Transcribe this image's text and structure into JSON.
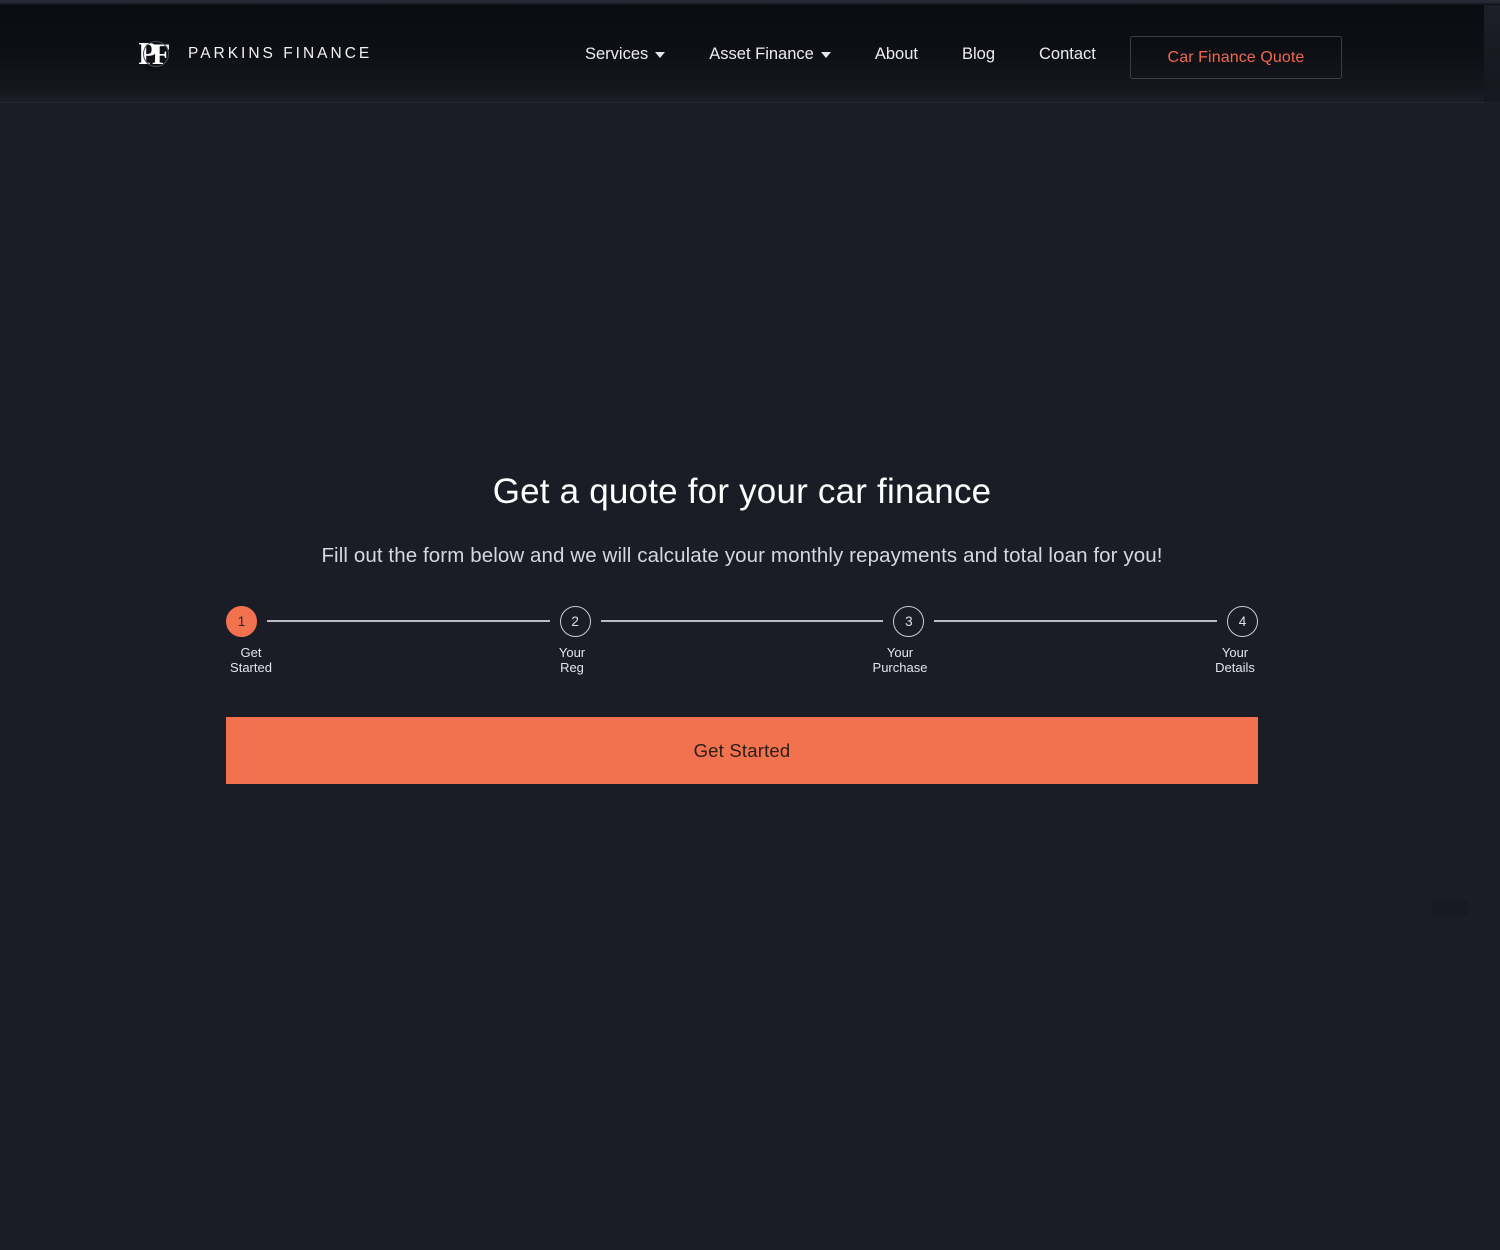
{
  "header": {
    "logo": {
      "mark": "pf-monogram",
      "text": "PARKINS FINANCE"
    },
    "nav": [
      {
        "label": "Services",
        "has_caret": true,
        "icon": "chevron-down-icon"
      },
      {
        "label": "Asset Finance",
        "has_caret": true,
        "icon": "chevron-down-icon"
      },
      {
        "label": "About",
        "has_caret": false
      },
      {
        "label": "Blog",
        "has_caret": false
      },
      {
        "label": "Contact",
        "has_caret": false
      }
    ],
    "cta": {
      "label": "Car Finance Quote"
    }
  },
  "main": {
    "title": "Get a quote for your car finance",
    "subtitle": "Fill out the form below and we will calculate your monthly repayments and total loan for you!",
    "stepper": {
      "steps": [
        {
          "number": "1",
          "label": "Get\nStarted",
          "state": "active"
        },
        {
          "number": "2",
          "label": "Your\nReg",
          "state": "idle"
        },
        {
          "number": "3",
          "label": "Your\nPurchase",
          "state": "idle"
        },
        {
          "number": "4",
          "label": "Your\nDetails",
          "state": "idle"
        }
      ]
    },
    "cta": {
      "label": "Get Started"
    }
  },
  "colors": {
    "accent": "#f2714f",
    "page_bg": "#1a1d26",
    "header_bg": "#0d0f15",
    "text_primary": "#ffffff",
    "text_secondary": "#d6d8de",
    "cta_text": "#2b2019"
  }
}
